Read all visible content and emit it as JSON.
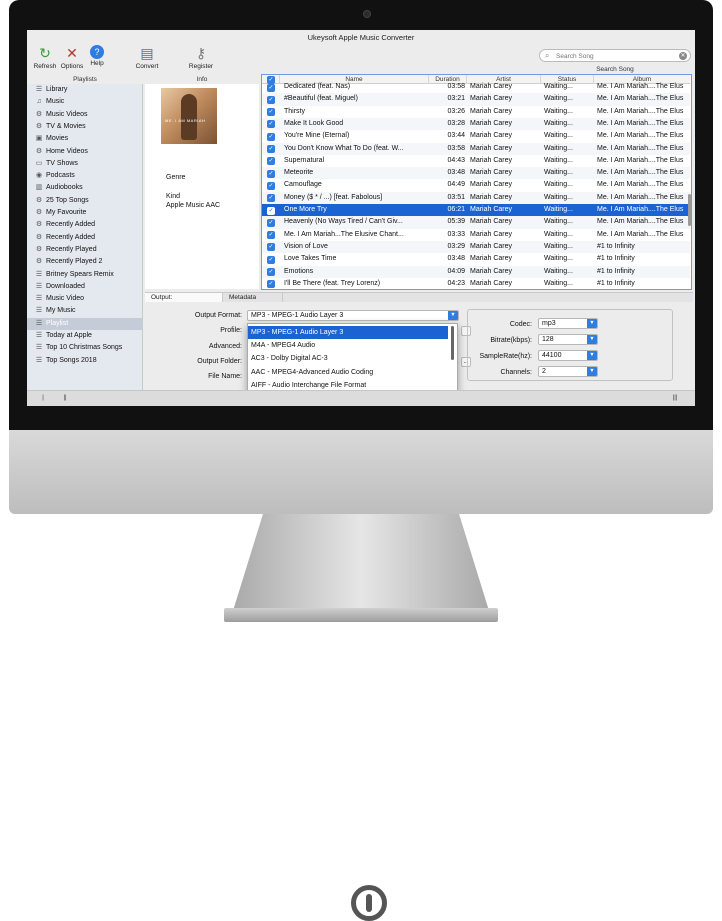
{
  "app": {
    "title": "Ukeysoft Apple Music Converter"
  },
  "toolbar": {
    "refresh": "Refresh",
    "options": "Options",
    "help": "Help",
    "convert": "Convert",
    "register": "Register"
  },
  "search": {
    "placeholder": "Search Song",
    "label": "Search Song"
  },
  "sidebar": {
    "header": "Playlists",
    "items": [
      {
        "label": "Library",
        "icon": "list-icon"
      },
      {
        "label": "Music",
        "icon": "music-note-icon"
      },
      {
        "label": "Music Videos",
        "icon": "gear-icon"
      },
      {
        "label": "TV & Movies",
        "icon": "gear-icon"
      },
      {
        "label": "Movies",
        "icon": "film-icon"
      },
      {
        "label": "Home Videos",
        "icon": "gear-icon"
      },
      {
        "label": "TV Shows",
        "icon": "tv-icon"
      },
      {
        "label": "Podcasts",
        "icon": "podcast-icon"
      },
      {
        "label": "Audiobooks",
        "icon": "book-icon"
      },
      {
        "label": "25 Top Songs",
        "icon": "gear-icon"
      },
      {
        "label": "My Favourite",
        "icon": "gear-icon"
      },
      {
        "label": "Recently Added",
        "icon": "gear-icon"
      },
      {
        "label": "Recently Added",
        "icon": "gear-icon"
      },
      {
        "label": "Recently Played",
        "icon": "gear-icon"
      },
      {
        "label": "Recently Played 2",
        "icon": "gear-icon"
      },
      {
        "label": "Britney Spears Remix",
        "icon": "list-icon"
      },
      {
        "label": "Downloaded",
        "icon": "list-icon"
      },
      {
        "label": "Music Video",
        "icon": "list-icon"
      },
      {
        "label": "My Music",
        "icon": "list-icon"
      },
      {
        "label": "Playlist",
        "icon": "list-icon"
      },
      {
        "label": "Today at Apple",
        "icon": "list-icon"
      },
      {
        "label": "Top 10 Christmas Songs",
        "icon": "list-icon"
      },
      {
        "label": "Top Songs 2018",
        "icon": "list-icon"
      }
    ],
    "selected_index": 19
  },
  "info": {
    "header": "Info",
    "album_text": "ME. I AM MARIAH",
    "genre_label": "Genre",
    "kind_label": "Kind",
    "kind_value": "Apple Music AAC"
  },
  "table": {
    "columns": [
      "",
      "Name",
      "Duration",
      "Artist",
      "Status",
      "Album"
    ],
    "rows": [
      {
        "name": "Dedicated (feat. Nas)",
        "duration": "03:58",
        "artist": "Mariah Carey",
        "status": "Waiting...",
        "album": "Me. I Am Mariah....The Elus"
      },
      {
        "name": "#Beautiful (feat. Miguel)",
        "duration": "03:21",
        "artist": "Mariah Carey",
        "status": "Waiting...",
        "album": "Me. I Am Mariah....The Elus"
      },
      {
        "name": "Thirsty",
        "duration": "03:26",
        "artist": "Mariah Carey",
        "status": "Waiting...",
        "album": "Me. I Am Mariah....The Elus"
      },
      {
        "name": "Make It Look Good",
        "duration": "03:28",
        "artist": "Mariah Carey",
        "status": "Waiting...",
        "album": "Me. I Am Mariah....The Elus"
      },
      {
        "name": "You're Mine (Eternal)",
        "duration": "03:44",
        "artist": "Mariah Carey",
        "status": "Waiting...",
        "album": "Me. I Am Mariah....The Elus"
      },
      {
        "name": "You Don't Know What To Do (feat. W...",
        "duration": "03:58",
        "artist": "Mariah Carey",
        "status": "Waiting...",
        "album": "Me. I Am Mariah....The Elus"
      },
      {
        "name": "Supernatural",
        "duration": "04:43",
        "artist": "Mariah Carey",
        "status": "Waiting...",
        "album": "Me. I Am Mariah....The Elus"
      },
      {
        "name": "Meteorite",
        "duration": "03:48",
        "artist": "Mariah Carey",
        "status": "Waiting...",
        "album": "Me. I Am Mariah....The Elus"
      },
      {
        "name": "Camouflage",
        "duration": "04:49",
        "artist": "Mariah Carey",
        "status": "Waiting...",
        "album": "Me. I Am Mariah....The Elus"
      },
      {
        "name": "Money ($ * / ...) [feat. Fabolous]",
        "duration": "03:51",
        "artist": "Mariah Carey",
        "status": "Waiting...",
        "album": "Me. I Am Mariah....The Elus"
      },
      {
        "name": "One More Try",
        "duration": "06:21",
        "artist": "Mariah Carey",
        "status": "Waiting...",
        "album": "Me. I Am Mariah....The Elus"
      },
      {
        "name": "Heavenly (No Ways Tired / Can't Giv...",
        "duration": "05:39",
        "artist": "Mariah Carey",
        "status": "Waiting...",
        "album": "Me. I Am Mariah....The Elus"
      },
      {
        "name": "Me. I Am Mariah...The Elusive Chant...",
        "duration": "03:33",
        "artist": "Mariah Carey",
        "status": "Waiting...",
        "album": "Me. I Am Mariah....The Elus"
      },
      {
        "name": "Vision of Love",
        "duration": "03:29",
        "artist": "Mariah Carey",
        "status": "Waiting...",
        "album": "#1 to Infinity"
      },
      {
        "name": "Love Takes Time",
        "duration": "03:48",
        "artist": "Mariah Carey",
        "status": "Waiting...",
        "album": "#1 to Infinity"
      },
      {
        "name": "Emotions",
        "duration": "04:09",
        "artist": "Mariah Carey",
        "status": "Waiting...",
        "album": "#1 to Infinity"
      },
      {
        "name": "I'll Be There (feat. Trey Lorenz)",
        "duration": "04:23",
        "artist": "Mariah Carey",
        "status": "Waiting...",
        "album": "#1 to Infinity"
      }
    ],
    "selected_index": 10
  },
  "bottom_tabs": {
    "output": "Output:",
    "metadata": "Metadata"
  },
  "output": {
    "format_label": "Output Format:",
    "format_value": "MP3 - MPEG-1 Audio Layer 3",
    "profile_label": "Profile:",
    "advanced_label": "Advanced:",
    "folder_label": "Output Folder:",
    "filename_label": "File Name:",
    "dots": "...",
    "format_options": [
      "MP3 - MPEG-1 Audio Layer 3",
      "M4A - MPEG4 Audio",
      "AC3 - Dolby Digital AC-3",
      "AAC - MPEG4-Advanced Audio Coding",
      "AIFF - Audio Interchange File Format"
    ],
    "format_selected_index": 0
  },
  "codec": {
    "codec_label": "Codec:",
    "codec_value": "mp3",
    "bitrate_label": "Bitrate(kbps):",
    "bitrate_value": "128",
    "samplerate_label": "SampleRate(hz):",
    "samplerate_value": "44100",
    "channels_label": "Channels:",
    "channels_value": "2"
  },
  "statusbar": {
    "left1": "|",
    "left2": "||",
    "right": "|||"
  },
  "colors": {
    "accent": "#1b63d3",
    "table_border": "#6c9de3",
    "sidebar_bg": "#e4e8ef"
  }
}
